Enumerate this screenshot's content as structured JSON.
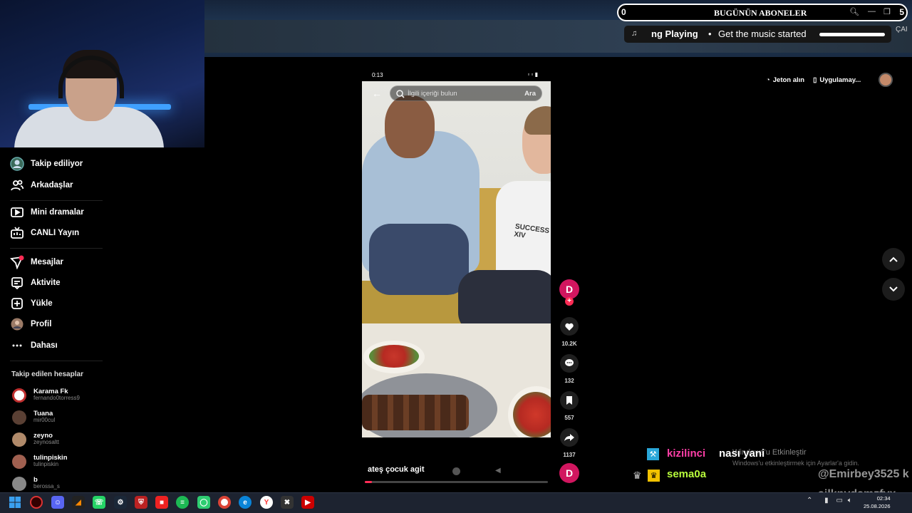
{
  "overlay": {
    "subs_left": "0",
    "subs_title": "BUGÜNÜN ABONELER",
    "subs_right": "5",
    "now_playing_label": "ng Playing",
    "now_playing_sep": "•",
    "now_playing_song": "Get the music started",
    "topbar_right_text": "ÇAI"
  },
  "sidebar": {
    "items": [
      {
        "label": "Takip ediliyor",
        "icon": "following-avatar-icon"
      },
      {
        "label": "Arkadaşlar",
        "icon": "friends-icon"
      },
      {
        "label": "Mini dramalar",
        "icon": "mini-drama-icon"
      },
      {
        "label": "CANLI Yayın",
        "icon": "live-tv-icon"
      },
      {
        "label": "Mesajlar",
        "icon": "messages-icon"
      },
      {
        "label": "Aktivite",
        "icon": "activity-icon"
      },
      {
        "label": "Yükle",
        "icon": "upload-icon"
      },
      {
        "label": "Profil",
        "icon": "profile-avatar-icon"
      },
      {
        "label": "Dahası",
        "icon": "more-icon"
      }
    ],
    "following_title": "Takip edilen hesaplar",
    "accounts": [
      {
        "name": "Karama Fk",
        "handle": "fernando0torress9",
        "color": "#c03030"
      },
      {
        "name": "Tuana",
        "handle": "mir00cul",
        "color": "#7a5a4a"
      },
      {
        "name": "zeyno",
        "handle": "zeynosaltt",
        "color": "#b08a6a"
      },
      {
        "name": "tulinpiskin",
        "handle": "tulinpiskin",
        "color": "#a06050"
      },
      {
        "name": "b",
        "handle": "berossa_s",
        "color": "#888888"
      }
    ]
  },
  "video": {
    "search_placeholder": "İlgili içeriği bulun",
    "search_button": "Ara",
    "caption": "ateş çocuk agit",
    "shirt_text": "SUCCESS XIV",
    "progress_pct": 4,
    "status_time": "0:13"
  },
  "actions": {
    "creator_initial": "D",
    "likes": "10.2K",
    "comments": "132",
    "saves": "557",
    "shares": "1137",
    "sound_initial": "D"
  },
  "header": {
    "coins_label": "Jeton alın",
    "app_label": "Uygulamay..."
  },
  "chat": {
    "line1_user": "kizilinci",
    "line1_msg": "nası yani",
    "line2_user": "sema0a",
    "windows_activate": "Windows'u Etkinleştir",
    "windows_activate_sub": "Windows'u etkinleştirmek için Ayarlar'a gidin.",
    "watermark1": "@Emirbey3525 k",
    "watermark2": "sjlknvdsmzfvx"
  },
  "taskbar": {
    "time": "02:34",
    "date": "25.08.2026"
  },
  "colors": {
    "accent": "#fe2c55",
    "creator_avatar": "#d1165f"
  }
}
